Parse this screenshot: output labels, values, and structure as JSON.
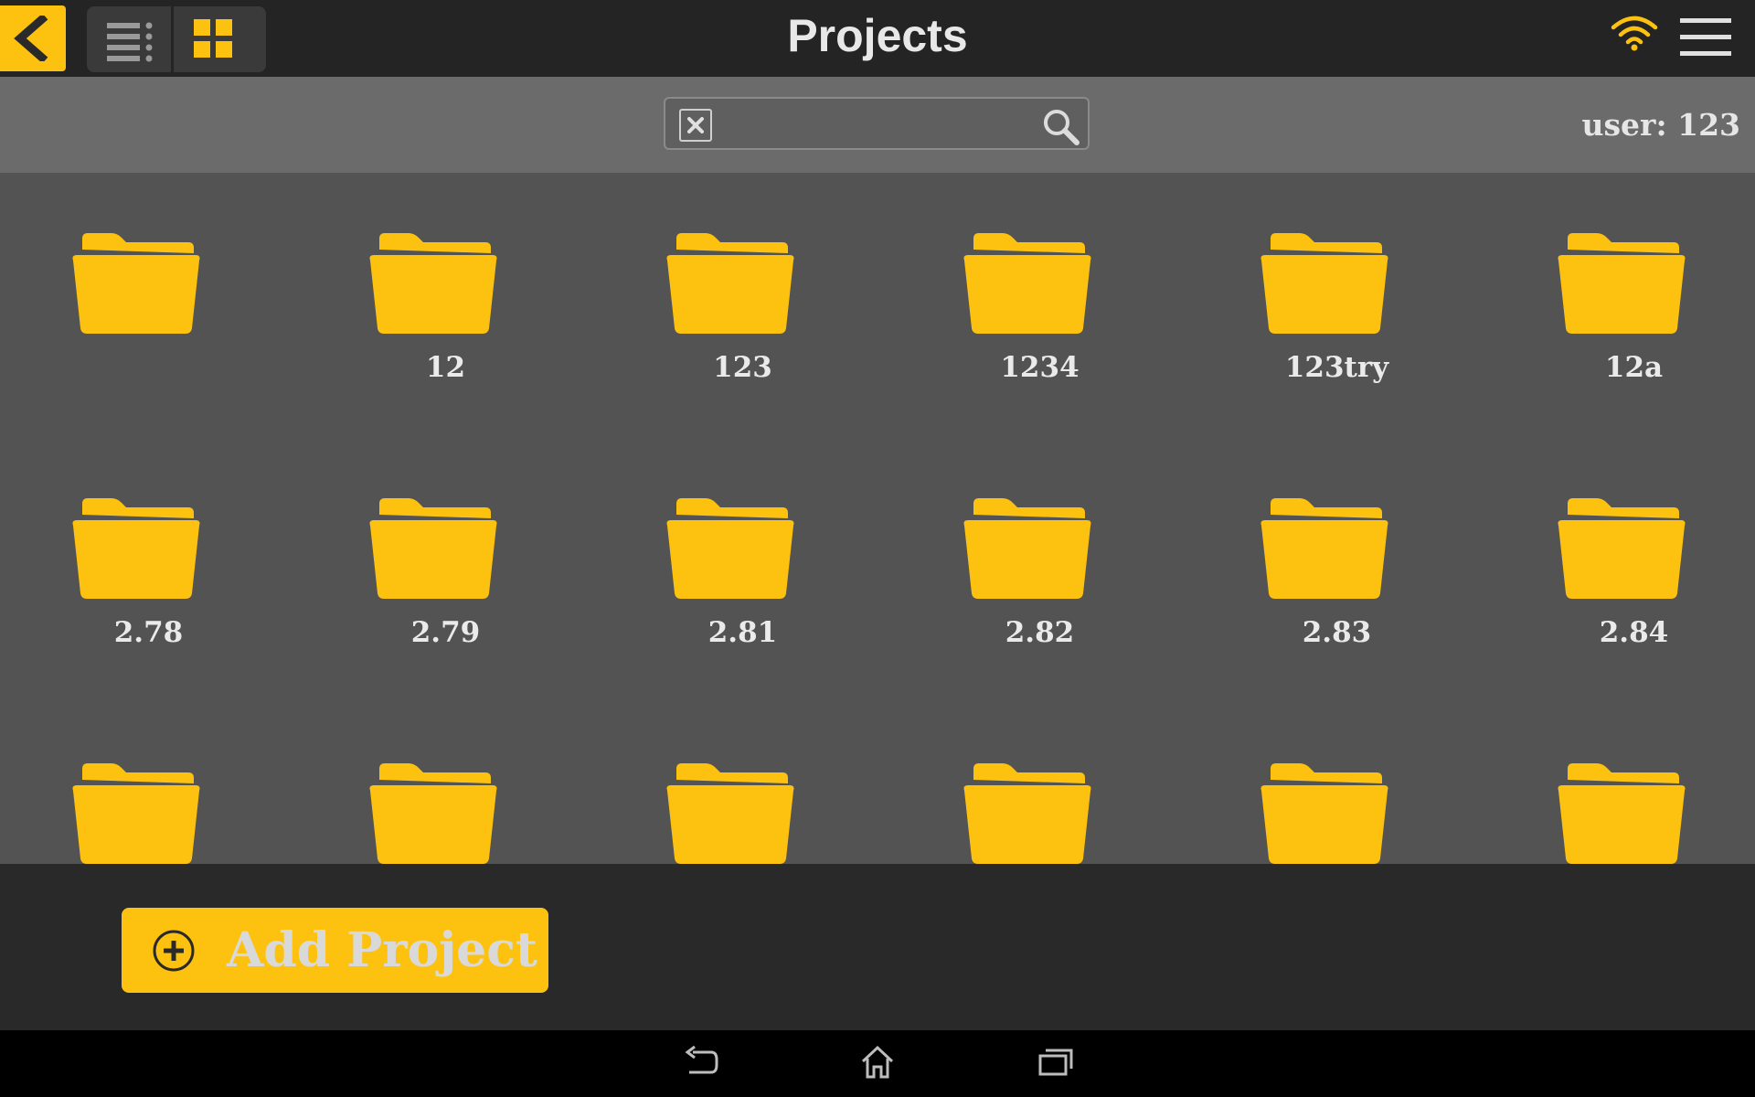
{
  "header": {
    "title": "Projects",
    "back_icon": "chevron-left-icon",
    "list_view_icon": "list-view-icon",
    "grid_view_icon": "grid-view-icon",
    "wifi_icon": "wifi-icon",
    "menu_icon": "hamburger-menu-icon"
  },
  "search": {
    "value": "",
    "placeholder": "",
    "clear_icon": "close-icon",
    "search_icon": "search-icon"
  },
  "user": {
    "label": "user: 123"
  },
  "folders": [
    {
      "label": ""
    },
    {
      "label": "12"
    },
    {
      "label": "123"
    },
    {
      "label": "1234"
    },
    {
      "label": "123try"
    },
    {
      "label": "12a"
    },
    {
      "label": "2.78"
    },
    {
      "label": "2.79"
    },
    {
      "label": "2.81"
    },
    {
      "label": "2.82"
    },
    {
      "label": "2.83"
    },
    {
      "label": "2.84"
    },
    {
      "label": ""
    },
    {
      "label": ""
    },
    {
      "label": ""
    },
    {
      "label": ""
    },
    {
      "label": ""
    },
    {
      "label": ""
    }
  ],
  "actions": {
    "add_project_label": "Add Project",
    "add_icon": "plus-circle-icon"
  },
  "system_nav": {
    "back_icon": "back-icon",
    "home_icon": "home-icon",
    "recents_icon": "recent-apps-icon"
  },
  "colors": {
    "accent": "#fdc20f",
    "header_bg": "#242424",
    "search_bar_bg": "#6b6b6b",
    "grid_bg": "#535353",
    "footer_bg": "#292929",
    "nav_bg": "#000000"
  }
}
